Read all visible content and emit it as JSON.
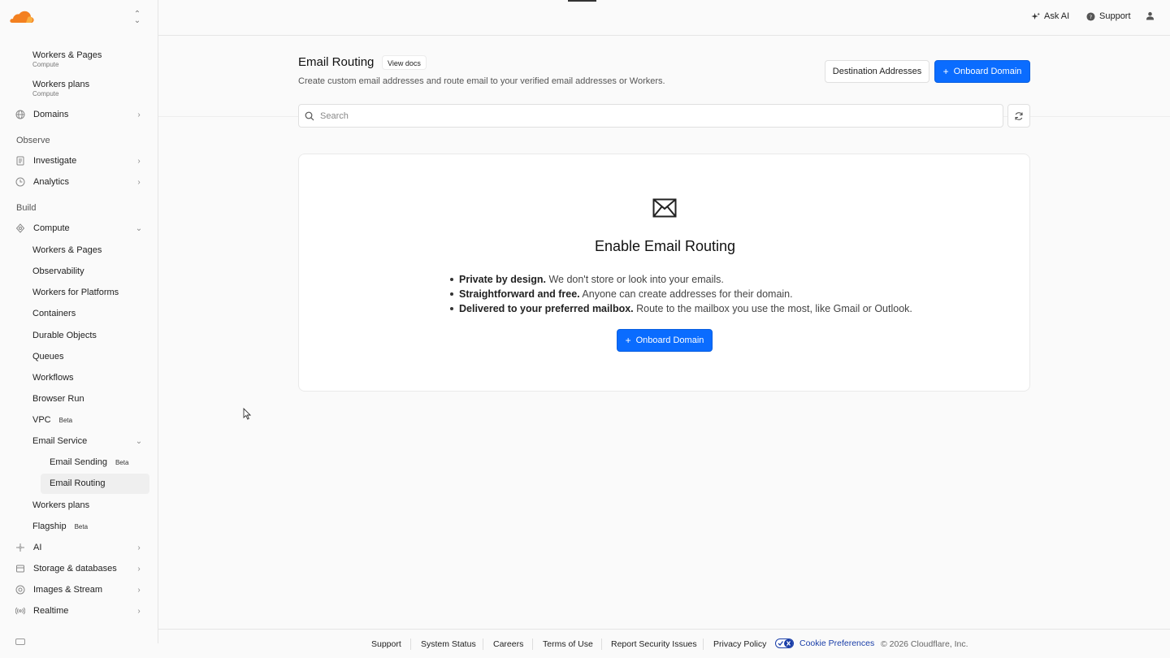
{
  "sidebar": {
    "items": [
      {
        "name": "workers-pages-top",
        "label": "Workers & Pages",
        "caption": "Compute"
      },
      {
        "name": "workers-plans-top",
        "label": "Workers plans",
        "caption": "Compute"
      },
      {
        "name": "domains",
        "label": "Domains"
      },
      {
        "name": "investigate",
        "label": "Investigate"
      },
      {
        "name": "analytics",
        "label": "Analytics"
      },
      {
        "name": "compute",
        "label": "Compute"
      },
      {
        "name": "ai",
        "label": "AI"
      },
      {
        "name": "storage",
        "label": "Storage & databases"
      },
      {
        "name": "images",
        "label": "Images & Stream"
      },
      {
        "name": "realtime",
        "label": "Realtime"
      }
    ],
    "sections": {
      "observe": "Observe",
      "build": "Build"
    },
    "compute_children": [
      "Workers & Pages",
      "Observability",
      "Workers for Platforms",
      "Containers",
      "Durable Objects",
      "Queues",
      "Workflows",
      "Browser Run",
      "VPC",
      "Email Service",
      "Workers plans",
      "Flagship"
    ],
    "email_children": [
      "Email Sending",
      "Email Routing"
    ],
    "badge_beta": "Beta",
    "active_item": "Email Routing"
  },
  "header": {
    "ask_ai": "Ask AI",
    "support": "Support"
  },
  "main": {
    "title": "Email Routing",
    "view_docs": "View docs",
    "subtitle": "Create custom email addresses and route email to your verified email addresses or Workers.",
    "destination_addresses": "Destination Addresses",
    "onboard_domain": "Onboard Domain",
    "search_placeholder": "Search"
  },
  "card": {
    "title": "Enable Email Routing",
    "bullets": [
      {
        "bold": "Private by design.",
        "text": " We don't store or look into your emails."
      },
      {
        "bold": "Straightforward and free.",
        "text": " Anyone can create addresses for their domain."
      },
      {
        "bold": "Delivered to your preferred mailbox.",
        "text": " Route to the mailbox you use the most, like Gmail or Outlook."
      }
    ],
    "onboard_domain": "Onboard Domain"
  },
  "footer": {
    "links": [
      "Support",
      "System Status",
      "Careers",
      "Terms of Use",
      "Report Security Issues",
      "Privacy Policy"
    ],
    "cookie_preferences": "Cookie Preferences",
    "copyright": "© 2026 Cloudflare, Inc."
  },
  "colors": {
    "primary": "#0a6cff",
    "logo_orange": "#f38020",
    "logo_light": "#faae40",
    "cookie_blue": "#1a3ea8"
  },
  "icons": [
    "cloudflare-logo",
    "chevron-up-down-icon",
    "globe-icon",
    "document-icon",
    "clock-icon",
    "compute-icon",
    "sparkle-icon",
    "database-icon",
    "image-icon",
    "realtime-icon",
    "help-icon",
    "user-icon",
    "search-icon",
    "refresh-icon",
    "mail-icon",
    "plus-icon",
    "cookie-toggle-icon"
  ]
}
